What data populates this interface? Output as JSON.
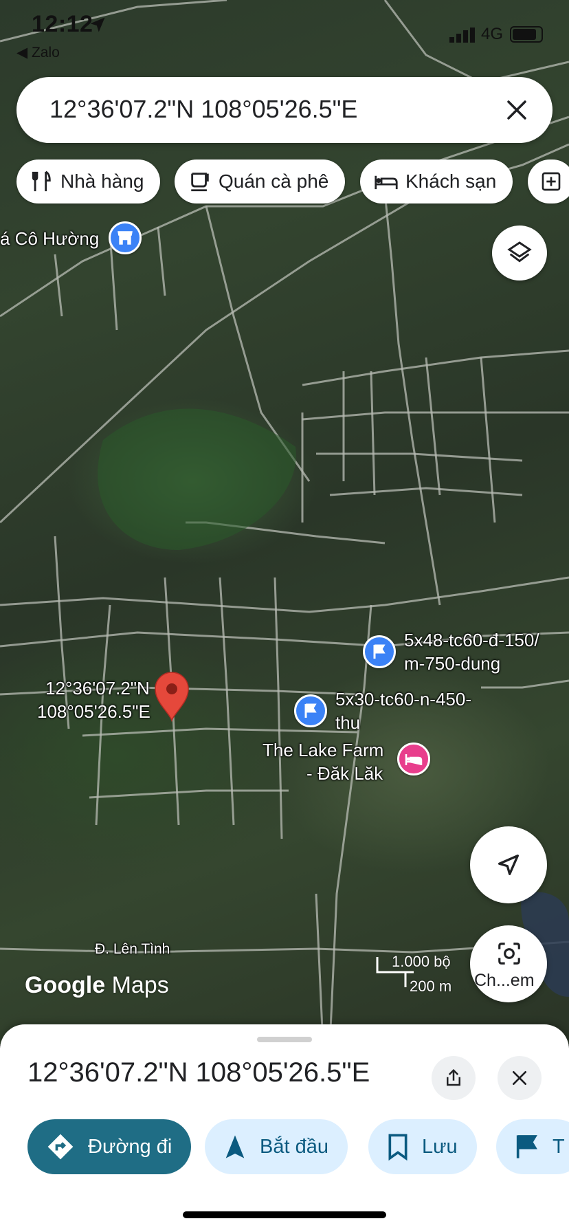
{
  "status_bar": {
    "time": "12:12",
    "back_app": "◀ Zalo",
    "network": "4G"
  },
  "search": {
    "query": "12°36'07.2\"N 108°05'26.5\"E"
  },
  "chips": [
    {
      "label": "Nhà hàng",
      "icon": "restaurant-icon"
    },
    {
      "label": "Quán cà phê",
      "icon": "coffee-icon"
    },
    {
      "label": "Khách sạn",
      "icon": "hotel-icon"
    }
  ],
  "map": {
    "labels": {
      "place_top": "á Cô Hường",
      "pin_line1": "12°36'07.2\"N",
      "pin_line2": "108°05'26.5\"E",
      "poi1_line1": "5x48-tc60-đ-150/",
      "poi1_line2": "m-750-dung",
      "poi2_line1": "5x30-tc60-n-450-",
      "poi2_line2": "thu",
      "hotel_line1": "The Lake Farm",
      "hotel_line2": "- Đăk Lăk",
      "road": "Đ. Lên Tình"
    },
    "logo": {
      "google": "Google",
      "maps": "Maps"
    },
    "scale": {
      "imperial": "1.000 bộ",
      "metric": "200 m"
    },
    "colors": {
      "pin": "#e5483b",
      "poi_blue": "#3b82f6",
      "hotel_pink": "#e83e8c"
    }
  },
  "lens": {
    "label": "Ch...em"
  },
  "sheet": {
    "title": "12°36'07.2\"N 108°05'26.5\"E",
    "actions": [
      {
        "label": "Đường đi",
        "icon": "directions-icon"
      },
      {
        "label": "Bắt đầu",
        "icon": "navigation-arrow-icon"
      },
      {
        "label": "Lưu",
        "icon": "bookmark-icon"
      },
      {
        "label": "T",
        "icon": "flag-icon"
      }
    ],
    "colors": {
      "primary": "#1f6d85",
      "secondary": "#dcefff"
    }
  }
}
